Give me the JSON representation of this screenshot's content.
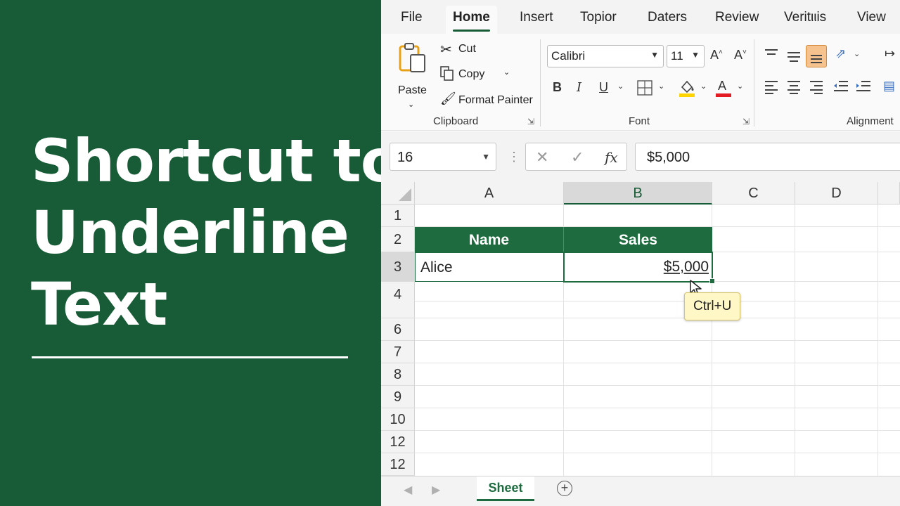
{
  "hero": {
    "title_lines": [
      "Shortcut to",
      "Underline",
      "Text"
    ]
  },
  "ribbon": {
    "tabs": [
      "File",
      "Home",
      "Insert",
      "Topior",
      "Daters",
      "Review",
      "Veritιιis",
      "View"
    ],
    "active_tab": "Home",
    "clipboard": {
      "paste_label": "Paste",
      "cut_label": "Cut",
      "copy_label": "Copy",
      "format_painter_label": "Format Painter",
      "group_label": "Clipboard"
    },
    "font": {
      "font_name": "Calibri",
      "font_size": "11",
      "bold_label": "B",
      "italic_label": "I",
      "underline_label": "U",
      "group_label": "Font"
    },
    "alignment": {
      "group_label": "Alignment"
    }
  },
  "formula_bar": {
    "name_box": "16",
    "formula_value": "$5,000"
  },
  "grid": {
    "columns": [
      "A",
      "B",
      "C",
      "D"
    ],
    "selected_column": "B",
    "rows": [
      "1",
      "2",
      "3",
      "4",
      "6",
      "7",
      "8",
      "9",
      "10",
      "12",
      "12"
    ],
    "table_headers": [
      "Name",
      "Sales"
    ],
    "cells": {
      "a3": "Alice",
      "b3": "$5,000"
    },
    "tooltip": "Ctrl+U"
  },
  "sheets": {
    "active_sheet": "Sheet"
  },
  "colors": {
    "brand_green": "#185c37",
    "table_header_green": "#1d6b3e",
    "tooltip_fill": "#fff7c6",
    "fill_color_swatch": "#ffd400",
    "font_color_swatch": "#e31c23",
    "align_active": "#f6c28e"
  }
}
